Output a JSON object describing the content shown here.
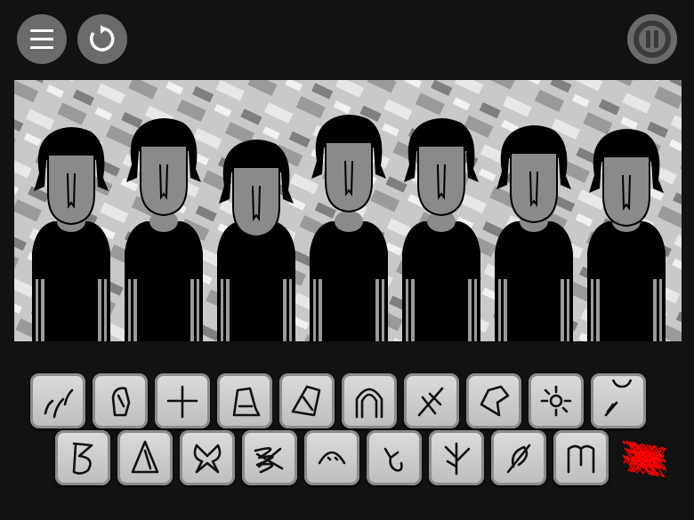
{
  "controls": {
    "menu": "menu-icon",
    "reset": "reset-icon",
    "pause": "pause-icon"
  },
  "colors": {
    "background": "#121212",
    "button": "#6b6b6b",
    "character_skin": "#8a8a8a",
    "character_body": "#000000",
    "special_red": "#ff0000"
  },
  "stage": {
    "character_count": 7
  },
  "sound_icons_row1": [
    "scratch-marks-icon",
    "boot-icon",
    "cross-icon",
    "stamp-icon",
    "shard-icon",
    "arch-icon",
    "slash-icon",
    "bird-icon",
    "burst-icon",
    "lamp-icon"
  ],
  "sound_icons_row2": [
    "b-glyph-icon",
    "triangle-icon",
    "butterfly-icon",
    "scribble-icon",
    "smile-arc-icon",
    "sprout-icon",
    "branch-icon",
    "feather-icon",
    "m-glyph-icon",
    "red-noise-icon"
  ]
}
